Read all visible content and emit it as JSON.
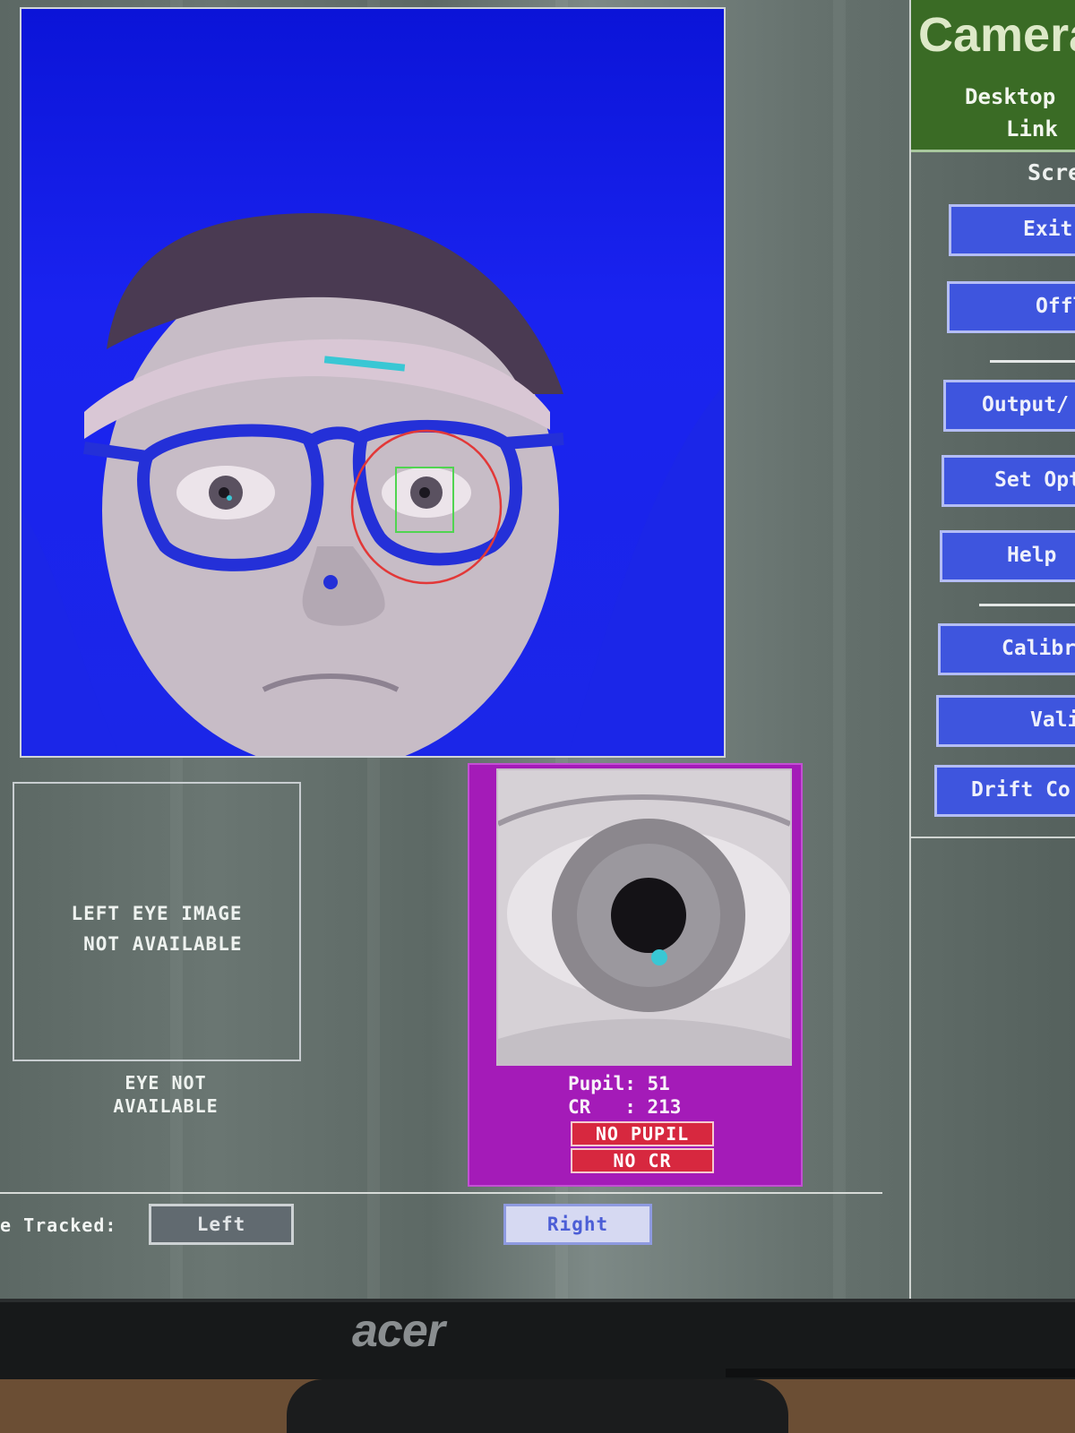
{
  "left_eye": {
    "message": "LEFT EYE IMAGE\n NOT AVAILABLE",
    "status": "EYE NOT\nAVAILABLE"
  },
  "right_eye": {
    "pupil_readout": "Pupil: 51",
    "cr_readout": "CR   : 213",
    "no_pupil": "NO PUPIL",
    "no_cr": "NO  CR"
  },
  "eye_tracked": {
    "label": "e Tracked:",
    "left": "Left",
    "right": "Right",
    "selected": "Right"
  },
  "sidebar": {
    "title": "Camera",
    "subtitle_line1": "Desktop",
    "subtitle_line2": "Link",
    "screen_label": "Scre",
    "buttons": [
      "Exit",
      "Offl",
      "Output/",
      "Set Opt",
      "Help",
      "Calibr",
      "Valida",
      "Drift Co"
    ]
  },
  "monitor": {
    "brand": "acer"
  },
  "colors": {
    "camera_bg": "#1a23f0",
    "right_panel": "#a41bb8",
    "status_red": "#d7283f",
    "sidebar_header": "#3a6b25",
    "sidebar_button": "#3e55de"
  }
}
